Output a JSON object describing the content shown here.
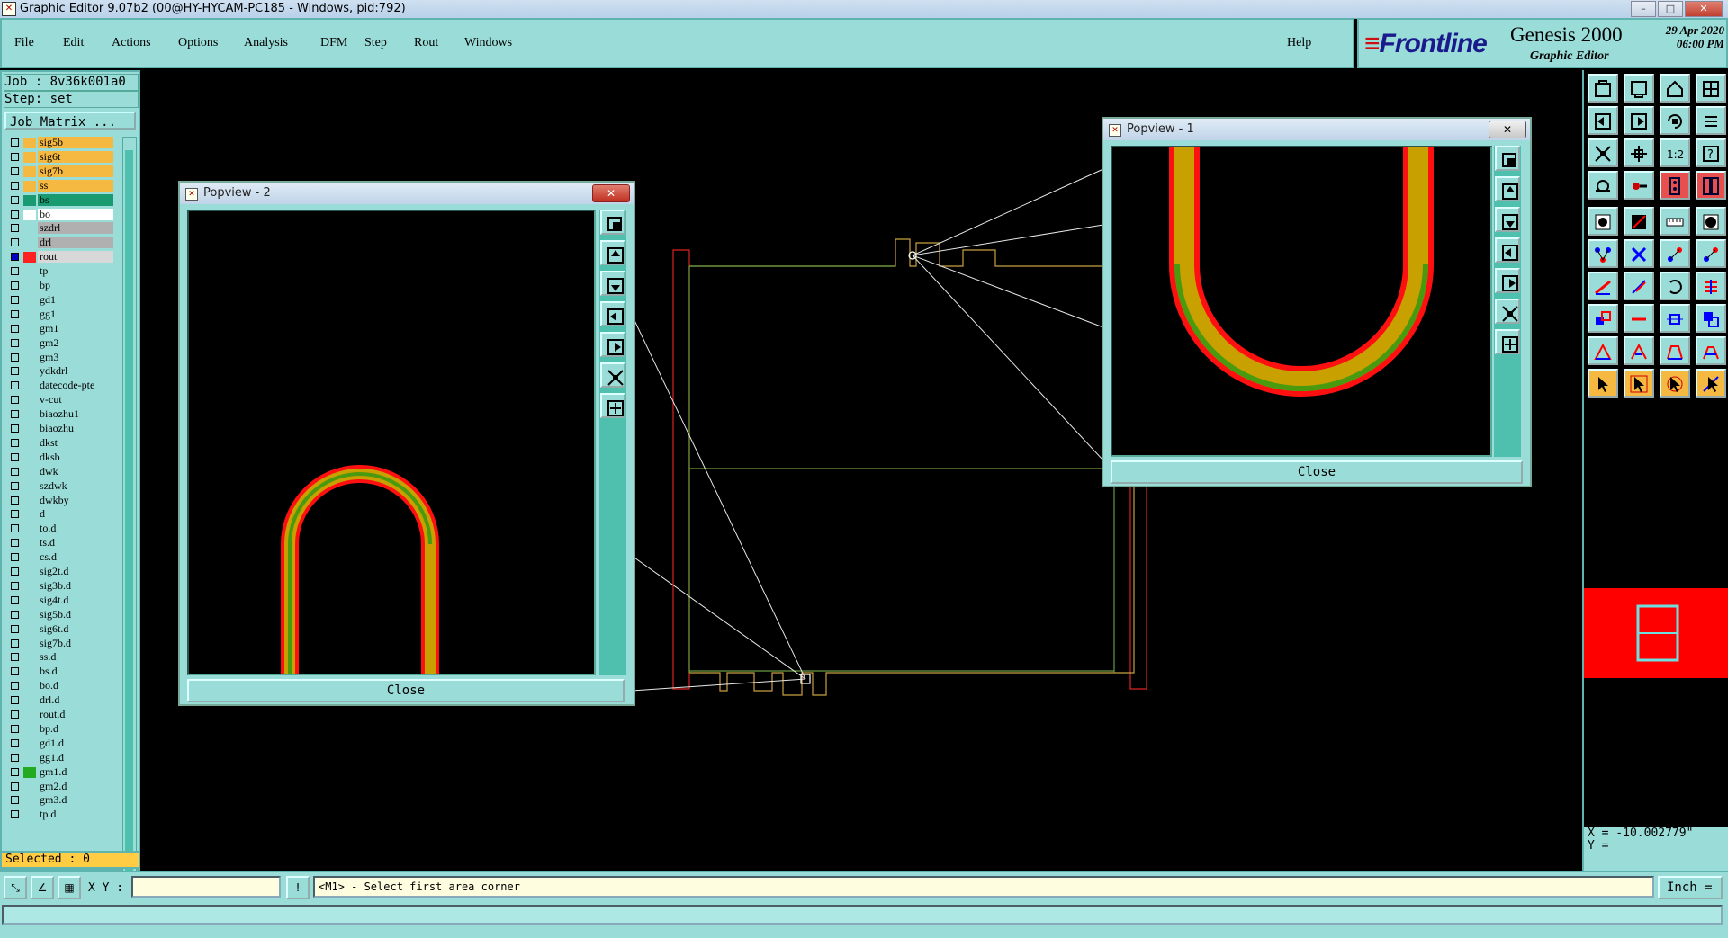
{
  "window": {
    "title": "Graphic Editor 9.07b2 (00@HY-HYCAM-PC185 - Windows, pid:792)",
    "minimize": "–",
    "maximize": "□",
    "close": "✕"
  },
  "menu": {
    "items": [
      "File",
      "Edit",
      "Actions",
      "Options",
      "Analysis",
      "DFM",
      "Step",
      "Rout",
      "Windows"
    ],
    "help": "Help"
  },
  "brand": {
    "logo": "Frontline",
    "product": "Genesis 2000",
    "subtitle": "Graphic Editor",
    "date": "29 Apr 2020",
    "time": "06:00 PM"
  },
  "job": {
    "job_label": "Job : 8v36k001a0",
    "step_label": "Step: set",
    "matrix_button": "Job Matrix ..."
  },
  "layers": [
    {
      "name": "sig5b",
      "color": "#f5b840",
      "bg": "#f5b840",
      "checked": false
    },
    {
      "name": "sig6t",
      "color": "#f5b840",
      "bg": "#f5b840",
      "checked": false
    },
    {
      "name": "sig7b",
      "color": "#f5b840",
      "bg": "#f5b840",
      "checked": false
    },
    {
      "name": "ss",
      "color": "#f5b840",
      "bg": "#f5b840",
      "checked": false
    },
    {
      "name": "bs",
      "color": "#1a9a70",
      "bg": "#1a9a70",
      "checked": false
    },
    {
      "name": "bo",
      "color": "#ffffff",
      "bg": "#ffffff",
      "checked": false
    },
    {
      "name": "szdrl",
      "color": "#9adcd8",
      "bg": "#b0b0b0",
      "checked": false
    },
    {
      "name": "drl",
      "color": "#9adcd8",
      "bg": "#b0b0b0",
      "checked": false
    },
    {
      "name": "rout",
      "color": "#ff2020",
      "bg": "#d8d8d8",
      "checked": true
    },
    {
      "name": "tp",
      "color": "#9adcd8",
      "bg": "#9adcd8",
      "checked": false
    },
    {
      "name": "bp",
      "color": "#9adcd8",
      "bg": "#9adcd8",
      "checked": false
    },
    {
      "name": "gd1",
      "color": "#9adcd8",
      "bg": "#9adcd8",
      "checked": false
    },
    {
      "name": "gg1",
      "color": "#9adcd8",
      "bg": "#9adcd8",
      "checked": false
    },
    {
      "name": "gm1",
      "color": "#9adcd8",
      "bg": "#9adcd8",
      "checked": false
    },
    {
      "name": "gm2",
      "color": "#9adcd8",
      "bg": "#9adcd8",
      "checked": false
    },
    {
      "name": "gm3",
      "color": "#9adcd8",
      "bg": "#9adcd8",
      "checked": false
    },
    {
      "name": "ydkdrl",
      "color": "#9adcd8",
      "bg": "#9adcd8",
      "checked": false
    },
    {
      "name": "datecode-pte",
      "color": "#9adcd8",
      "bg": "#9adcd8",
      "checked": false
    },
    {
      "name": "v-cut",
      "color": "#9adcd8",
      "bg": "#9adcd8",
      "checked": false
    },
    {
      "name": "biaozhu1",
      "color": "#9adcd8",
      "bg": "#9adcd8",
      "checked": false
    },
    {
      "name": "biaozhu",
      "color": "#9adcd8",
      "bg": "#9adcd8",
      "checked": false
    },
    {
      "name": "dkst",
      "color": "#9adcd8",
      "bg": "#9adcd8",
      "checked": false
    },
    {
      "name": "dksb",
      "color": "#9adcd8",
      "bg": "#9adcd8",
      "checked": false
    },
    {
      "name": "dwk",
      "color": "#9adcd8",
      "bg": "#9adcd8",
      "checked": false
    },
    {
      "name": "szdwk",
      "color": "#9adcd8",
      "bg": "#9adcd8",
      "checked": false
    },
    {
      "name": "dwkby",
      "color": "#9adcd8",
      "bg": "#9adcd8",
      "checked": false
    },
    {
      "name": "d",
      "color": "#9adcd8",
      "bg": "#9adcd8",
      "checked": false
    },
    {
      "name": "to.d",
      "color": "#9adcd8",
      "bg": "#9adcd8",
      "checked": false
    },
    {
      "name": "ts.d",
      "color": "#9adcd8",
      "bg": "#9adcd8",
      "checked": false
    },
    {
      "name": "cs.d",
      "color": "#9adcd8",
      "bg": "#9adcd8",
      "checked": false
    },
    {
      "name": "sig2t.d",
      "color": "#9adcd8",
      "bg": "#9adcd8",
      "checked": false
    },
    {
      "name": "sig3b.d",
      "color": "#9adcd8",
      "bg": "#9adcd8",
      "checked": false
    },
    {
      "name": "sig4t.d",
      "color": "#9adcd8",
      "bg": "#9adcd8",
      "checked": false
    },
    {
      "name": "sig5b.d",
      "color": "#9adcd8",
      "bg": "#9adcd8",
      "checked": false
    },
    {
      "name": "sig6t.d",
      "color": "#9adcd8",
      "bg": "#9adcd8",
      "checked": false
    },
    {
      "name": "sig7b.d",
      "color": "#9adcd8",
      "bg": "#9adcd8",
      "checked": false
    },
    {
      "name": "ss.d",
      "color": "#9adcd8",
      "bg": "#9adcd8",
      "checked": false
    },
    {
      "name": "bs.d",
      "color": "#9adcd8",
      "bg": "#9adcd8",
      "checked": false
    },
    {
      "name": "bo.d",
      "color": "#9adcd8",
      "bg": "#9adcd8",
      "checked": false
    },
    {
      "name": "drl.d",
      "color": "#9adcd8",
      "bg": "#9adcd8",
      "checked": false
    },
    {
      "name": "rout.d",
      "color": "#9adcd8",
      "bg": "#9adcd8",
      "checked": false
    },
    {
      "name": "bp.d",
      "color": "#9adcd8",
      "bg": "#9adcd8",
      "checked": false
    },
    {
      "name": "gd1.d",
      "color": "#9adcd8",
      "bg": "#9adcd8",
      "checked": false
    },
    {
      "name": "gg1.d",
      "color": "#9adcd8",
      "bg": "#9adcd8",
      "checked": false
    },
    {
      "name": "gm1.d",
      "color": "#22aa22",
      "bg": "#9adcd8",
      "checked": false
    },
    {
      "name": "gm2.d",
      "color": "#9adcd8",
      "bg": "#9adcd8",
      "checked": false
    },
    {
      "name": "gm3.d",
      "color": "#9adcd8",
      "bg": "#9adcd8",
      "checked": false
    },
    {
      "name": "tp.d",
      "color": "#9adcd8",
      "bg": "#9adcd8",
      "checked": false
    }
  ],
  "selected": "Selected : 0",
  "popview1": {
    "title": "Popview - 1",
    "close_label": "Close",
    "x_icon": "✕"
  },
  "popview2": {
    "title": "Popview - 2",
    "close_label": "Close",
    "x_icon": "✕"
  },
  "coords": {
    "x": "X = -10.002779\"",
    "y": "Y ="
  },
  "status": {
    "xy_label": "X Y :",
    "xy_value": "",
    "alert_icon": "!",
    "message": "<M1> - Select first area corner",
    "units": "Inch ="
  },
  "colors": {
    "panel": "#9adcd8",
    "accent": "#4fbfae",
    "rout": "#ff2020",
    "gold": "#c8a000",
    "green": "#4a9a10"
  }
}
